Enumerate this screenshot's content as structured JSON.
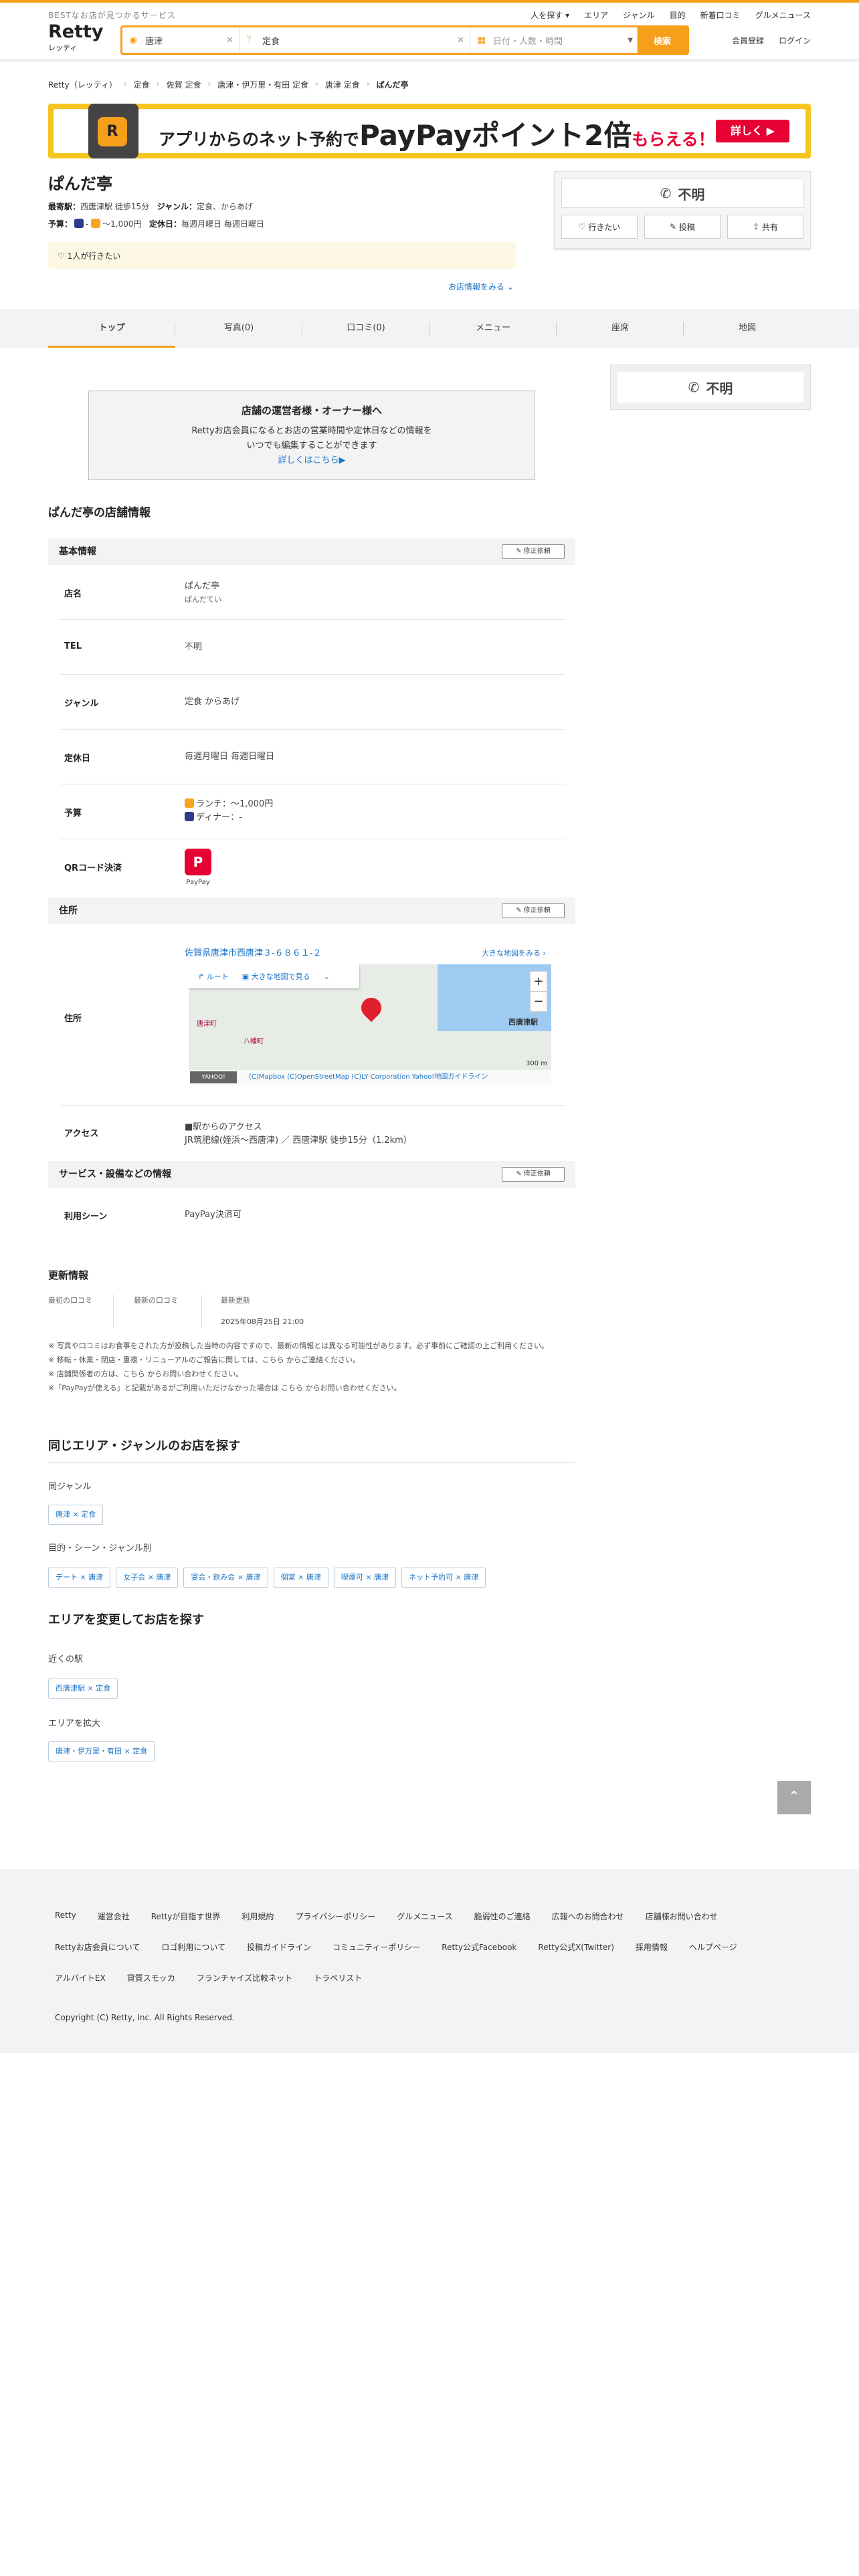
{
  "header": {
    "tagline": "BESTなお店が見つかるサービス",
    "logo_main": "Retty",
    "logo_sub": "レッティ",
    "search_area": "唐津",
    "search_keyword": "定食",
    "search_datetime_placeholder": "日付・人数・時間",
    "search_button": "検索",
    "nav": [
      "人を探す ▾",
      "エリア",
      "ジャンル",
      "目的",
      "新着口コミ",
      "グルメニュース"
    ],
    "register": "会員登録",
    "login": "ログイン"
  },
  "breadcrumb": [
    "Retty（レッティ）",
    "定食",
    "佐賀 定食",
    "唐津・伊万里・有田 定食",
    "唐津 定食",
    "ぱんだ亭"
  ],
  "banner": {
    "app_letter": "R",
    "text_pre": "アプリからのネット予約で",
    "text_big": "PayPayポイント2倍",
    "text_post": "もらえる！",
    "button": "詳しく ▶"
  },
  "shop": {
    "name": "ぱんだ亭",
    "station_label": "最寄駅：",
    "station": "西唐津駅 徒歩15分",
    "genre_label": "ジャンル：",
    "genre": "定食、からあげ",
    "budget_label": "予算：",
    "budget_lunch": "〜1,000円",
    "holiday_label": "定休日：",
    "holiday": "毎週月曜日 毎週日曜日",
    "want_text": "1人が行きたい",
    "more_info": "お店情報をみる ⌄"
  },
  "actions": {
    "tel": "不明",
    "want": "行きたい",
    "post": "投稿",
    "share": "共有"
  },
  "tabs": [
    "トップ",
    "写真(0)",
    "口コミ(0)",
    "メニュー",
    "座席",
    "地図"
  ],
  "owner": {
    "title": "店舗の運営者様・オーナー様へ",
    "line1": "Rettyお店会員になるとお店の営業時間や定休日などの情報を",
    "line2": "いつでも編集することができます",
    "link": "詳しくはこちら▶"
  },
  "info_title": "ぱんだ亭の店舗情報",
  "basic": {
    "bar": "基本情報",
    "edit": "修正依頼",
    "name_k": "店名",
    "name_v": "ぱんだ亭",
    "name_kana": "ぱんだてい",
    "tel_k": "TEL",
    "tel_v": "不明",
    "genre_k": "ジャンル",
    "genre_v": "定食 からあげ",
    "holiday_k": "定休日",
    "holiday_v": "毎週月曜日 毎週日曜日",
    "budget_k": "予算",
    "budget_lunch": "ランチ：〜1,000円",
    "budget_dinner": "ディナー：-",
    "qr_k": "QRコード決済",
    "qr_v": "PayPay"
  },
  "address": {
    "bar": "住所",
    "edit": "修正依頼",
    "k": "住所",
    "text": "佐賀県唐津市西唐津３-６８６１-２",
    "bigmap": "大きな地図をみる ›",
    "route": "ルート",
    "bigview": "大きな地図で見る",
    "station_label": "西唐津駅",
    "area1": "八幡町",
    "area2": "唐津町",
    "scale": "300 m",
    "credit": "(C)Mapbox (C)OpenStreetMap (C)LY Corporation Yahoo!地図ガイドライン",
    "yahoo": "YAHOO!",
    "access_k": "アクセス",
    "access1": "■駅からのアクセス",
    "access2": "JR筑肥線(姪浜〜西唐津) ／ 西唐津駅 徒歩15分（1.2km）"
  },
  "service": {
    "bar": "サービス・設備などの情報",
    "edit": "修正依頼",
    "k": "利用シーン",
    "v": "PayPay決済可"
  },
  "update": {
    "title": "更新情報",
    "first_review": "最初の口コミ",
    "last_review": "最新の口コミ",
    "last_update": "最新更新",
    "date": "2025年08月25日 21:00"
  },
  "notes": [
    "※ 写真や口コミはお食事をされた方が投稿した当時の内容ですので、最新の情報とは異なる可能性があります。必ず事前にご確認の上ご利用ください。",
    "※ 移転・休業・閉店・重複・リニューアルのご報告に関しては、こちら からご連絡ください。",
    "※ 店舗関係者の方は、こちら からお問い合わせください。",
    "※「PayPayが使える」と記載があるがご利用いただけなかった場合は こちら からお問い合わせください。"
  ],
  "same_area": {
    "title": "同じエリア・ジャンルのお店を探す",
    "genre_label": "同ジャンル",
    "genre_chips": [
      "唐津 × 定食"
    ],
    "scene_label": "目的・シーン・ジャンル別",
    "scene_chips": [
      "デート × 唐津",
      "女子会 × 唐津",
      "宴会・飲み会 × 唐津",
      "個室 × 唐津",
      "喫煙可 × 唐津",
      "ネット予約可 × 唐津"
    ]
  },
  "change_area": {
    "title": "エリアを変更してお店を探す",
    "near_label": "近くの駅",
    "near_chips": [
      "西唐津駅 × 定食"
    ],
    "expand_label": "エリアを拡大",
    "expand_chips": [
      "唐津・伊万里・有田 × 定食"
    ]
  },
  "totop": "⌃",
  "footer": {
    "row1": [
      "Retty",
      "運営会社",
      "Rettyが目指す世界",
      "利用規約",
      "プライバシーポリシー",
      "グルメニュース",
      "脆弱性のご連絡",
      "広報へのお問合わせ",
      "店舗様お問い合わせ"
    ],
    "row2": [
      "Rettyお店会員について",
      "ロゴ利用について",
      "投稿ガイドライン",
      "コミュニティーポリシー",
      "Retty公式Facebook",
      "Retty公式X(Twitter)",
      "採用情報",
      "ヘルプページ"
    ],
    "row3": [
      "アルバイトEX",
      "貸質スモッカ",
      "フランチャイズ比較ネット",
      "トラベリスト"
    ],
    "copyright": "Copyright (C) Retty, Inc. All Rights Reserved."
  },
  "colors": {
    "accent": "#f79e1b",
    "link": "#1a73c8",
    "paypay": "#e60033"
  }
}
